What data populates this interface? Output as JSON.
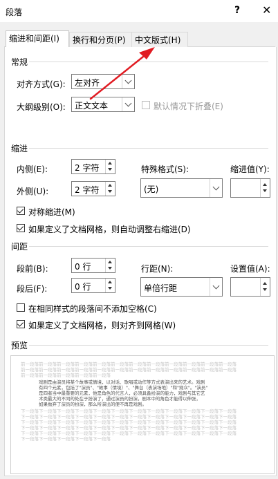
{
  "window": {
    "title": "段落",
    "help_label": "?",
    "close_label": "✕"
  },
  "tabs": [
    {
      "label": "缩进和间距(I)",
      "active": true
    },
    {
      "label": "换行和分页(P)",
      "active": false
    },
    {
      "label": "中文版式(H)",
      "active": false
    }
  ],
  "general": {
    "title": "常规",
    "alignment_label": "对齐方式(G):",
    "alignment_value": "左对齐",
    "outline_label": "大纲级别(O):",
    "outline_value": "正文文本",
    "collapse_label": "默认情况下折叠(E)",
    "collapse_checked": false
  },
  "indent": {
    "title": "缩进",
    "inside_label": "内侧(E):",
    "inside_value": "2 字符",
    "outside_label": "外侧(U):",
    "outside_value": "2 字符",
    "special_label": "特殊格式(S):",
    "special_value": "(无)",
    "by_label": "缩进值(Y):",
    "by_value": "",
    "mirror_label": "对称缩进(M)",
    "mirror_checked": true,
    "auto_right_label": "如果定义了文档网格，则自动调整右缩进(D)",
    "auto_right_checked": true
  },
  "spacing": {
    "title": "间距",
    "before_label": "段前(B):",
    "before_value": "0 行",
    "after_label": "段后(F):",
    "after_value": "0 行",
    "line_label": "行距(N):",
    "line_value": "单倍行距",
    "at_label": "设置值(A):",
    "at_value": "",
    "no_space_label": "在相同样式的段落间不添加空格(C)",
    "no_space_checked": false,
    "snap_grid_label": "如果定义了文档网格，则对齐到网格(W)",
    "snap_grid_checked": true
  },
  "preview": {
    "title": "预览",
    "prev_lines": [
      "前一段落前一段落前一段落前一段落前一段落前一段落前一段落前一段落前一段落前一段落前一段落前一段落",
      "前一段落前一段落前一段落前一段落前一段落前一段落前一段落前一段落前一段落前一段落前一段落前一段落",
      "前一段落前一段落前一段落前一段落前一段落"
    ],
    "sample_lines": [
      "戏剧是由演员将某个故事或情境，以对话、歌唱或动作等方式表演出来的艺术。戏剧",
      "有四个元素，包括了\"演员\"、\"故事（情境）\"、\"舞台（表演场地）\"和\"观众\"。\"演员\"",
      "是四者当中最重要的元素，他是角色的代言人，必须具备扮演的能力，戏剧与其它艺",
      "术类最大的不同的处在于扮演了，通过演员的扮演，剧本中的角色才能得以伸张，",
      "如果抛弃了演员的扮演，那么所演出的便不再是戏剧。"
    ],
    "next_lines": [
      "下一段落下一段落下一段落下一段落下一段落下一段落下一段落下一段落下一段落下一段落下一段落下一段落",
      "下一段落下一段落下一段落下一段落下一段落下一段落下一段落下一段落下一段落下一段落下一段落下一段落",
      "下一段落下一段落下一段落下一段落下一段落下一段落下一段落下一段落下一段落下一段落下一段落下一段落",
      "下一段落下一段落下一段落下一段落下一段落下一段落下一段落下一段落下一段落下一段落下一段落下一段落",
      "下一段落下一段落下一段落下一段落下一段落下一段落下一段落下一段落下一段落下一段落下一段落下一段落",
      "下一段落下一段落下一段落下一段落下一段落"
    ]
  },
  "annotation": {
    "color": "#e11b22"
  }
}
